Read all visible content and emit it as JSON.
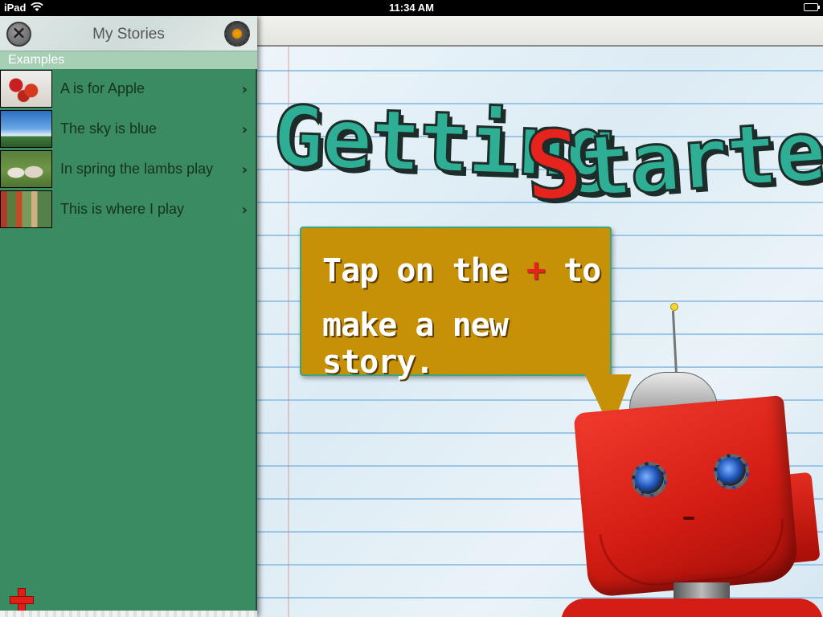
{
  "status_bar": {
    "device": "iPad",
    "time": "11:34 AM",
    "battery_level": 1.0
  },
  "sidebar": {
    "title": "My Stories",
    "close_icon": "close-icon",
    "settings_icon": "gear-icon",
    "section_header": "Examples",
    "stories": [
      {
        "label": "A is for Apple",
        "thumb": "apple"
      },
      {
        "label": "The sky is blue",
        "thumb": "sky"
      },
      {
        "label": "In spring the lambs play",
        "thumb": "lambs"
      },
      {
        "label": "This is where I play",
        "thumb": "play"
      }
    ],
    "chevron": "›",
    "add_icon": "plus-icon"
  },
  "main": {
    "title_word1": "Getting",
    "title_word2_first": "S",
    "title_word2_rest": "tarted",
    "bubble": {
      "line1_before": "Tap on the ",
      "line1_plus": "+",
      "line1_after": " to",
      "line2": "make a new story."
    }
  },
  "colors": {
    "sidebar_green": "#3a8a62",
    "section_header": "#a6cfb3",
    "title_teal": "#2fae96",
    "title_red": "#e6231c",
    "bubble_gold": "#c79107",
    "robot_red": "#d41d14"
  }
}
